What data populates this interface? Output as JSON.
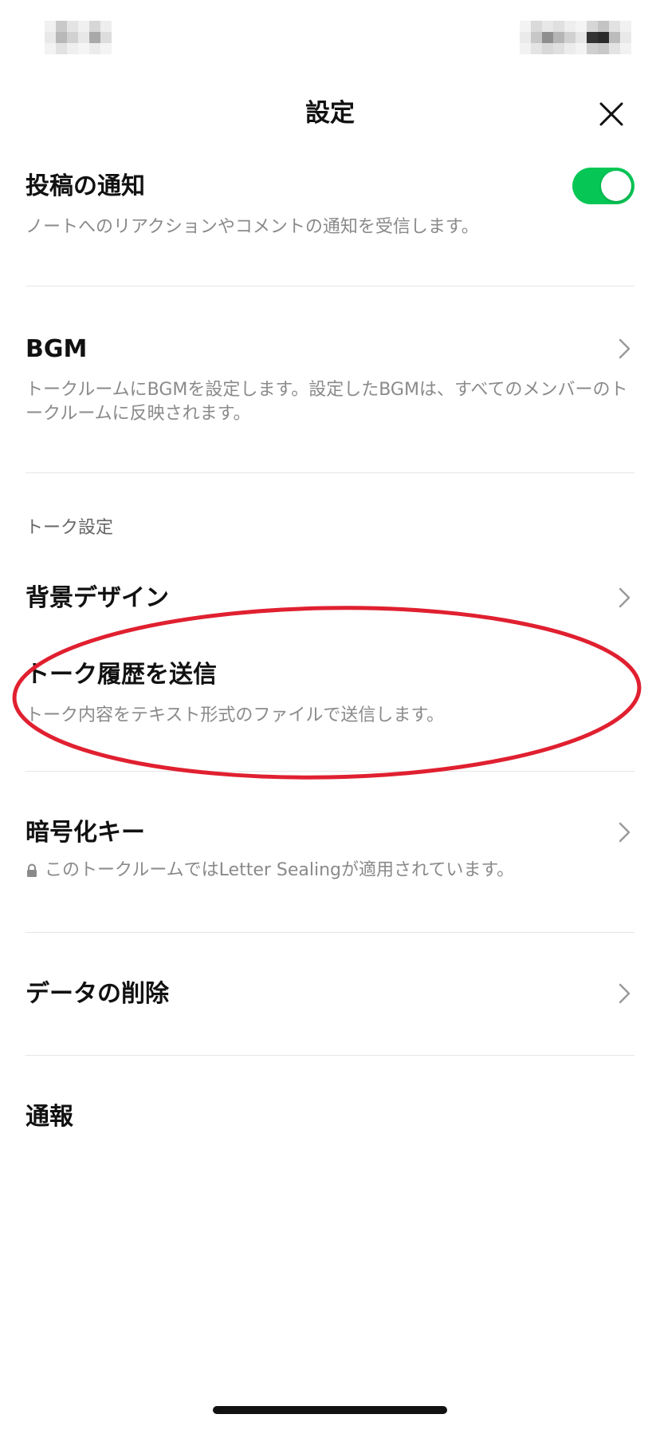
{
  "header": {
    "title": "設定",
    "close_icon": "close-icon"
  },
  "colors": {
    "toggle_on": "#06c755",
    "annotation": "#e02030",
    "text_primary": "#111111",
    "text_secondary": "#8a8a8a"
  },
  "post_notification": {
    "title": "投稿の通知",
    "description": "ノートへのリアクションやコメントの通知を受信します。",
    "toggle_on": true
  },
  "bgm": {
    "title": "BGM",
    "description": "トークルームにBGMを設定します。設定したBGMは、すべてのメンバーのトークルームに反映されます。"
  },
  "talk_settings": {
    "section_label": "トーク設定",
    "background_design": {
      "title": "背景デザイン"
    },
    "send_history": {
      "title": "トーク履歴を送信",
      "description": "トーク内容をテキスト形式のファイルで送信します。"
    },
    "encryption_key": {
      "title": "暗号化キー",
      "description": "このトークルームではLetter Sealingが適用されています。",
      "icon": "lock-icon"
    },
    "delete_data": {
      "title": "データの削除"
    },
    "report": {
      "title": "通報"
    }
  }
}
